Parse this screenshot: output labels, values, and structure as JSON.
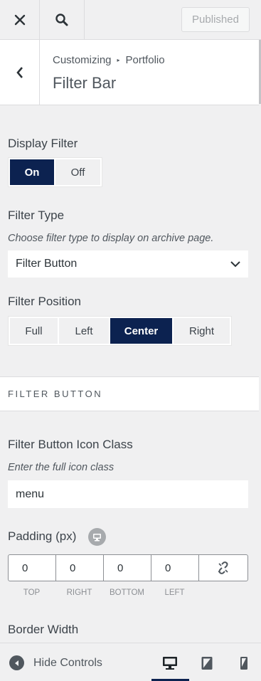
{
  "header": {
    "close_icon": "close-icon",
    "search_icon": "search-icon",
    "publish_label": "Published"
  },
  "section": {
    "breadcrumb_root": "Customizing",
    "breadcrumb_parent": "Portfolio",
    "title": "Filter Bar"
  },
  "display_filter": {
    "label": "Display Filter",
    "options": [
      "On",
      "Off"
    ],
    "selected": "On"
  },
  "filter_type": {
    "label": "Filter Type",
    "description": "Choose filter type to display on archive page.",
    "value": "Filter Button"
  },
  "filter_position": {
    "label": "Filter Position",
    "options": [
      "Full",
      "Left",
      "Center",
      "Right"
    ],
    "selected": "Center"
  },
  "filter_button_group": {
    "title": "FILTER BUTTON"
  },
  "icon_class": {
    "label": "Filter Button Icon Class",
    "description": "Enter the full icon class",
    "value": "menu"
  },
  "padding": {
    "label": "Padding (px)",
    "values": [
      "0",
      "0",
      "0",
      "0"
    ],
    "sides": [
      "TOP",
      "RIGHT",
      "BOTTOM",
      "LEFT"
    ]
  },
  "border_width": {
    "label": "Border Width"
  },
  "footer": {
    "hide_controls_label": "Hide Controls",
    "active_device": "desktop"
  },
  "colors": {
    "accent": "#0c2250",
    "background": "#f0f0f1"
  }
}
